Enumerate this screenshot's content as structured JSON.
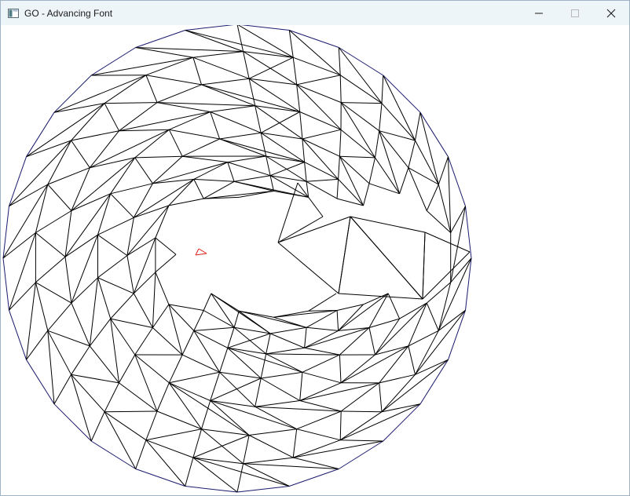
{
  "window": {
    "title": "GO - Advancing Font"
  },
  "icons": {
    "app": "app-window-icon",
    "minimize": "minimize-icon",
    "maximize": "maximize-icon",
    "close": "close-icon"
  },
  "colors": {
    "edge": "#000000",
    "boundary": "#1a1a6e",
    "active_front": "#e0201a",
    "titlebar": "#eef5f8"
  }
}
